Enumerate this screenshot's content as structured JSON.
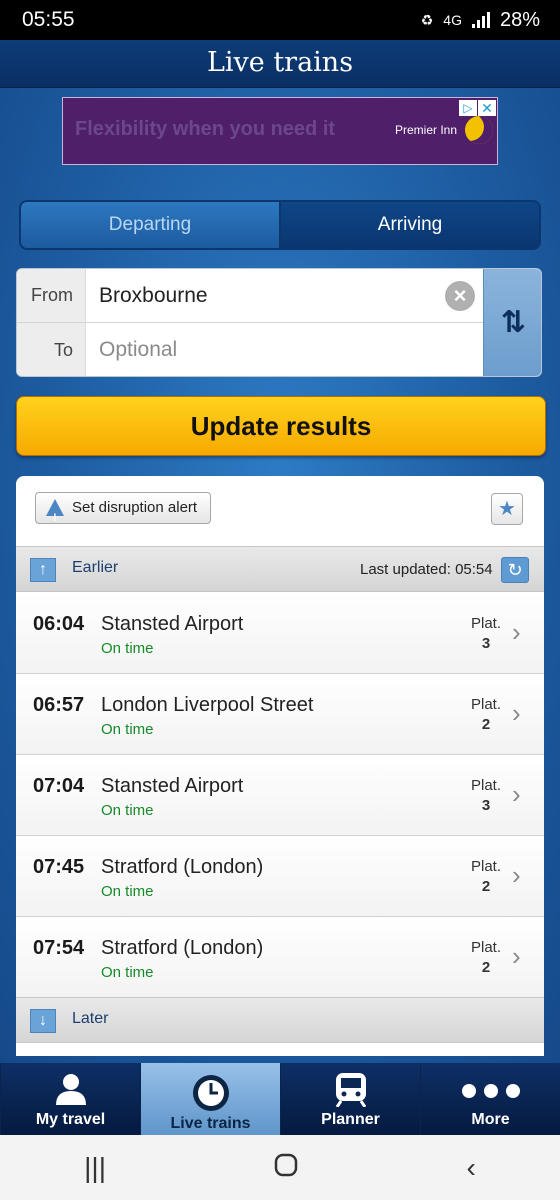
{
  "status_bar": {
    "time": "05:55",
    "network": "4G",
    "battery": "28%"
  },
  "header": {
    "title": "Live trains"
  },
  "ad": {
    "text": "Flexibility when you need it",
    "brand": "Premier Inn",
    "choices_icon": "ad-choices-icon",
    "close_icon": "close-icon"
  },
  "mode_toggle": {
    "departing": "Departing",
    "arriving": "Arriving",
    "selected": "arriving"
  },
  "journey_form": {
    "from_label": "From",
    "from_value": "Broxbourne",
    "to_label": "To",
    "to_placeholder": "Optional"
  },
  "update_button": "Update results",
  "disruption_button": "Set disruption alert",
  "earlier_label": "Earlier",
  "last_updated": "Last updated: 05:54",
  "later_label": "Later",
  "trains": [
    {
      "time": "06:04",
      "destination": "Stansted Airport",
      "status": "On time",
      "platform_label": "Plat.",
      "platform": "3"
    },
    {
      "time": "06:57",
      "destination": "London Liverpool Street",
      "status": "On time",
      "platform_label": "Plat.",
      "platform": "2"
    },
    {
      "time": "07:04",
      "destination": "Stansted Airport",
      "status": "On time",
      "platform_label": "Plat.",
      "platform": "3"
    },
    {
      "time": "07:45",
      "destination": "Stratford (London)",
      "status": "On time",
      "platform_label": "Plat.",
      "platform": "2"
    },
    {
      "time": "07:54",
      "destination": "Stratford (London)",
      "status": "On time",
      "platform_label": "Plat.",
      "platform": "2"
    }
  ],
  "tabs": [
    {
      "label": "My travel",
      "icon": "person-icon"
    },
    {
      "label": "Live trains",
      "icon": "clock-icon",
      "active": true
    },
    {
      "label": "Planner",
      "icon": "train-icon"
    },
    {
      "label": "More",
      "icon": "more-dots-icon"
    }
  ],
  "colors": {
    "on_time": "#178a2a",
    "update_button": "#f7a900",
    "header": "#0d3c78"
  }
}
